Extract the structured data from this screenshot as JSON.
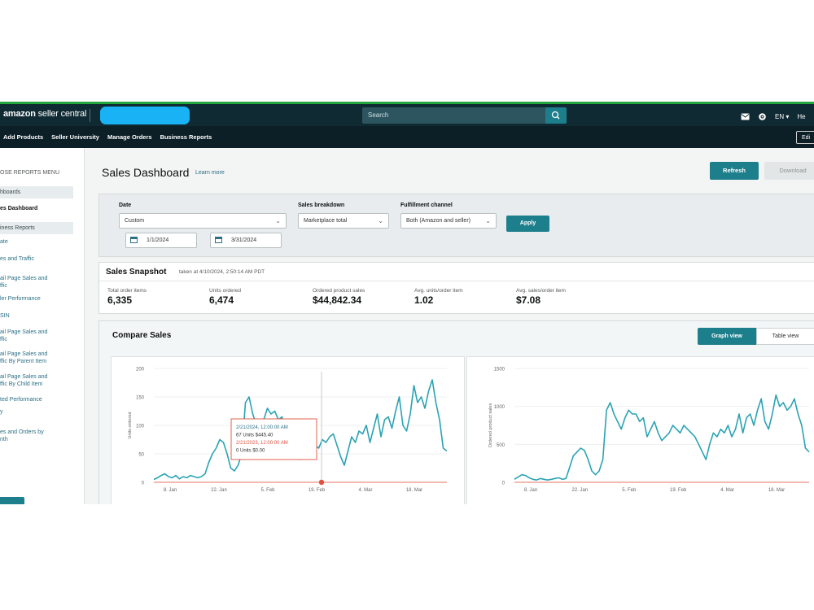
{
  "header": {
    "brand": "amazon",
    "brand_suffix": "seller central",
    "search_placeholder": "Search",
    "lang": "EN ▾",
    "help": "He"
  },
  "nav": {
    "items": [
      "Add Products",
      "Seller University",
      "Manage Orders",
      "Business Reports"
    ],
    "edit": "Edi"
  },
  "sidebar": {
    "menu_header": "OSE REPORTS MENU",
    "sections": [
      {
        "label": "hboards",
        "items": [
          {
            "label": "es Dashboard",
            "active": true
          }
        ]
      },
      {
        "label": "iness Reports",
        "items": [
          {
            "label": "ate"
          },
          {
            "label": "es and Traffic"
          },
          {
            "label": "ail Page Sales and\nffic"
          },
          {
            "label": "ler Performance"
          },
          {
            "label": "SIN"
          },
          {
            "label": "ail Page Sales and\nffic"
          },
          {
            "label": "ail Page Sales and\nffic By Parent Item"
          },
          {
            "label": "ail Page Sales and\nffic By Child Item"
          },
          {
            "label": "ted Performance"
          },
          {
            "label": "y"
          },
          {
            "label": "es and Orders by\nnth"
          }
        ]
      }
    ]
  },
  "page": {
    "title": "Sales Dashboard",
    "learn_more": "Learn more",
    "refresh": "Refresh",
    "download": "Download"
  },
  "filters": {
    "date_label": "Date",
    "date_value": "Custom",
    "start_date": "1/1/2024",
    "end_date": "3/31/2024",
    "breakdown_label": "Sales breakdown",
    "breakdown_value": "Marketplace total",
    "channel_label": "Fulfillment channel",
    "channel_value": "Both (Amazon and seller)",
    "apply": "Apply"
  },
  "snapshot": {
    "title": "Sales Snapshot",
    "taken_at": "taken at 4/10/2024, 2:50:14 AM PDT",
    "metrics": [
      {
        "label": "Total order items",
        "value": "6,335"
      },
      {
        "label": "Units ordered",
        "value": "6,474"
      },
      {
        "label": "Ordered product sales",
        "value": "$44,842.34"
      },
      {
        "label": "Avg. units/order item",
        "value": "1.02"
      },
      {
        "label": "Avg. sales/order item",
        "value": "$7.08"
      }
    ]
  },
  "compare": {
    "title": "Compare Sales",
    "graph_view": "Graph view",
    "table_view": "Table view"
  },
  "colors": {
    "teal": "#1e7f8c",
    "series_primary": "#2aa3b3",
    "series_compare": "#e0503c",
    "nav_dark": "#0f2a33"
  },
  "icons": [
    "search-icon",
    "mail-icon",
    "gear-icon",
    "calendar-icon",
    "chevron-down-icon"
  ],
  "chart_data": [
    {
      "type": "line",
      "ylabel": "Units ordered",
      "ylim": [
        0,
        200
      ],
      "yticks": [
        0,
        50,
        100,
        150,
        200
      ],
      "xticks": [
        "8. Jan",
        "22. Jan",
        "5. Feb",
        "19. Feb",
        "4. Mar",
        "18. Mar"
      ],
      "series": [
        {
          "values": [
            5,
            8,
            12,
            15,
            10,
            8,
            12,
            6,
            10,
            8,
            12,
            10,
            8,
            10,
            15,
            35,
            50,
            60,
            75,
            70,
            50,
            25,
            20,
            30,
            50,
            140,
            150,
            120,
            100,
            90,
            110,
            130,
            120,
            125,
            110,
            115,
            60,
            75,
            95,
            60,
            40,
            45,
            55,
            70,
            65,
            60,
            75,
            70,
            80,
            85,
            65,
            45,
            30,
            55,
            80,
            70,
            90,
            85,
            100,
            70,
            95,
            120,
            80,
            110,
            115,
            95,
            125,
            150,
            100,
            90,
            120,
            170,
            140,
            150,
            130,
            160,
            180,
            140,
            110,
            60,
            55
          ]
        },
        {
          "values": [
            0,
            0,
            0,
            0,
            0,
            0,
            0,
            0,
            0,
            0,
            0,
            0,
            0,
            0,
            0,
            0,
            0,
            0,
            0,
            0,
            0,
            0,
            0,
            0,
            0,
            0,
            0,
            0,
            0,
            0,
            0,
            0,
            0,
            0,
            0,
            0,
            0,
            0,
            0,
            0,
            0,
            0,
            0,
            0,
            0,
            0,
            0,
            0,
            0,
            0,
            0,
            0,
            0,
            0,
            0,
            0,
            0,
            0,
            0,
            0,
            0,
            0,
            0,
            0,
            0,
            0,
            0,
            0,
            0,
            0,
            0,
            0,
            0,
            0,
            0,
            0,
            0,
            0,
            0,
            0,
            0
          ]
        }
      ],
      "tooltip": {
        "line1": "2/21/2024, 12:00:00 AM",
        "line2": "67 Units $445.40",
        "line3": "2/21/2023, 12:00:00 AM",
        "line4": "0 Units $0.00"
      }
    },
    {
      "type": "line",
      "ylabel": "Ordered product sales",
      "ylim": [
        0,
        1500
      ],
      "yticks": [
        0,
        500,
        1000,
        1500
      ],
      "xticks": [
        "8. Jan",
        "22. Jan",
        "5. Feb",
        "19. Feb",
        "4. Mar",
        "18. Mar"
      ],
      "series": [
        {
          "values": [
            40,
            70,
            100,
            90,
            60,
            40,
            30,
            50,
            40,
            30,
            40,
            50,
            60,
            40,
            50,
            200,
            350,
            400,
            450,
            420,
            300,
            150,
            100,
            150,
            300,
            950,
            1050,
            900,
            800,
            700,
            850,
            950,
            900,
            900,
            800,
            850,
            600,
            700,
            800,
            650,
            550,
            600,
            650,
            750,
            700,
            650,
            750,
            700,
            650,
            600,
            500,
            400,
            300,
            500,
            650,
            600,
            700,
            650,
            750,
            600,
            700,
            900,
            650,
            850,
            900,
            750,
            950,
            1100,
            800,
            700,
            900,
            1150,
            1000,
            1050,
            950,
            1000,
            1100,
            900,
            750,
            450,
            400
          ]
        },
        {
          "values": [
            0,
            0,
            0,
            0,
            0,
            0,
            0,
            0,
            0,
            0,
            0,
            0,
            0,
            0,
            0,
            0,
            0,
            0,
            0,
            0,
            0,
            0,
            0,
            0,
            0,
            0,
            0,
            0,
            0,
            0,
            0,
            0,
            0,
            0,
            0,
            0,
            0,
            0,
            0,
            0,
            0,
            0,
            0,
            0,
            0,
            0,
            0,
            0,
            0,
            0,
            0,
            0,
            0,
            0,
            0,
            0,
            0,
            0,
            0,
            0,
            0,
            0,
            0,
            0,
            0,
            0,
            0,
            0,
            0,
            0,
            0,
            0,
            0,
            0,
            0,
            0,
            0,
            0,
            0,
            0,
            0
          ]
        }
      ]
    }
  ]
}
